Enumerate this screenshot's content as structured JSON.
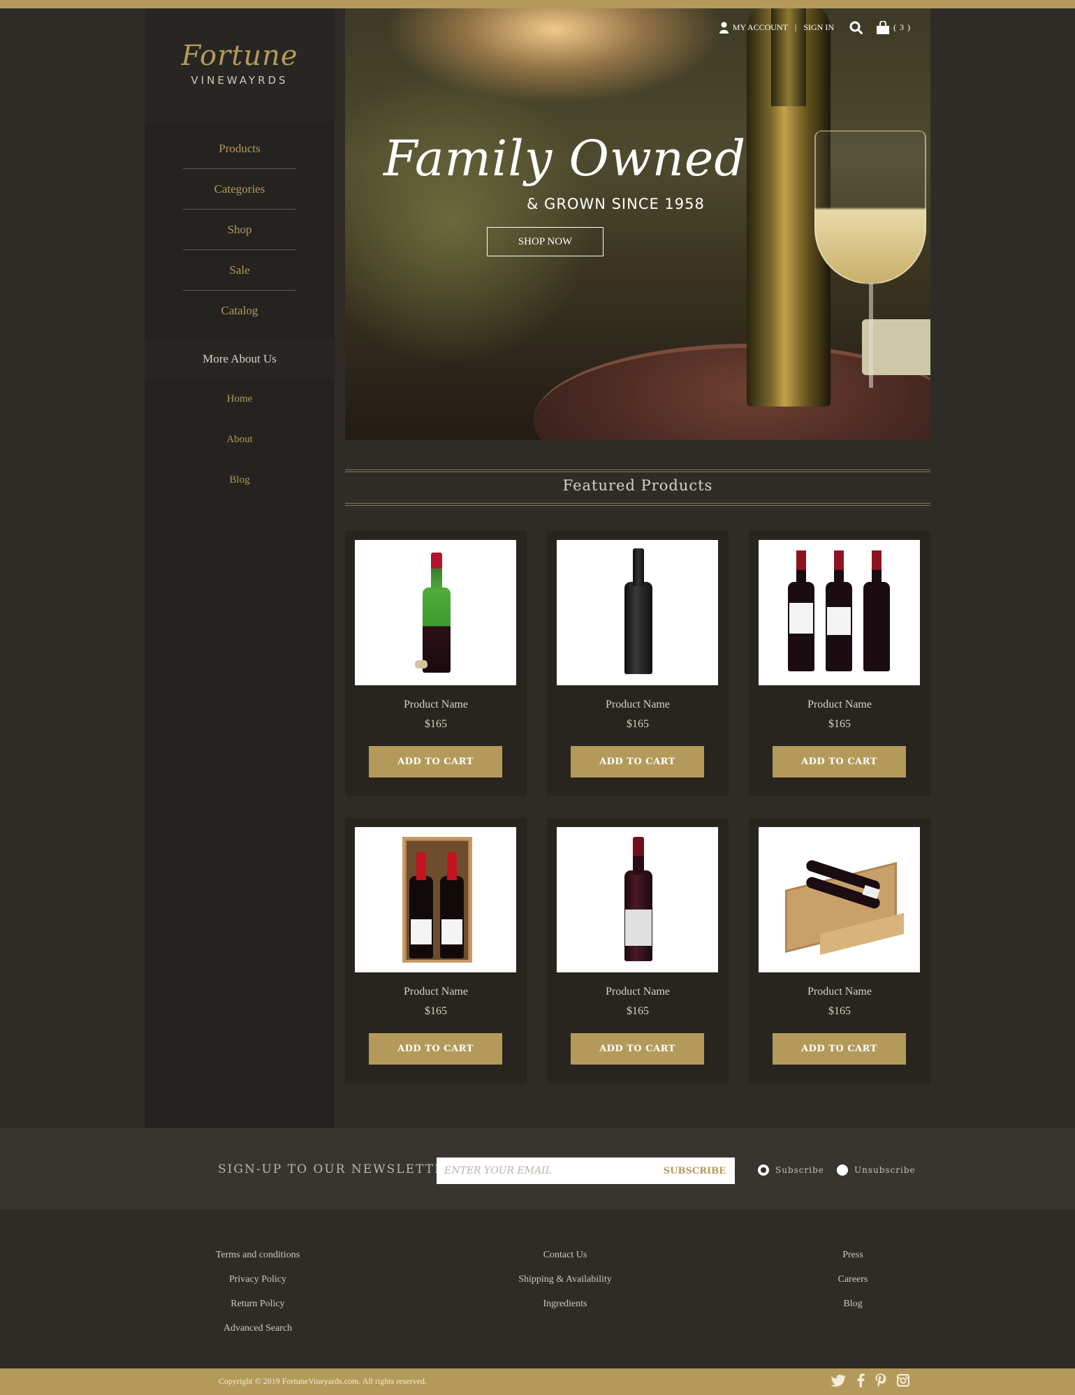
{
  "brand": {
    "logo_script": "Fortune",
    "logo_sub": "VINEWAYRDS"
  },
  "sidebar": {
    "items": [
      {
        "label": "Products"
      },
      {
        "label": "Categories"
      },
      {
        "label": "Shop"
      },
      {
        "label": "Sale"
      },
      {
        "label": "Catalog"
      }
    ],
    "more_heading": "More About Us",
    "more_items": [
      {
        "label": "Home"
      },
      {
        "label": "About"
      },
      {
        "label": "Blog"
      }
    ]
  },
  "header": {
    "account_label": "MY ACCOUNT",
    "separator": "|",
    "signin_label": "SIGN IN",
    "cart_count": "( 3 )"
  },
  "hero": {
    "title": "Family Owned",
    "subtitle": "& GROWN SINCE 1958",
    "cta": "SHOP NOW"
  },
  "featured": {
    "title": "Featured  Products",
    "products": [
      {
        "name": "Product Name",
        "price": "$165",
        "button": "ADD TO CART",
        "image": "green-wine-bottle-with-cork"
      },
      {
        "name": "Product Name",
        "price": "$165",
        "button": "ADD TO CART",
        "image": "black-wine-bottle"
      },
      {
        "name": "Product Name",
        "price": "$165",
        "button": "ADD TO CART",
        "image": "three-red-wine-bottles"
      },
      {
        "name": "Product Name",
        "price": "$165",
        "button": "ADD TO CART",
        "image": "two-bottles-in-gift-box"
      },
      {
        "name": "Product Name",
        "price": "$165",
        "button": "ADD TO CART",
        "image": "red-wine-bottle-white-label"
      },
      {
        "name": "Product Name",
        "price": "$165",
        "button": "ADD TO CART",
        "image": "wooden-crate-with-bottles"
      }
    ]
  },
  "newsletter": {
    "label": "SIGN-UP TO OUR NEWSLETTER",
    "placeholder": "ENTER YOUR EMAIL",
    "submit": "SUBSCRIBE",
    "options": [
      {
        "label": "Subscribe",
        "selected": true
      },
      {
        "label": "Unsubscribe",
        "selected": false
      }
    ]
  },
  "footer": {
    "col1": [
      "Terms and conditions",
      "Privacy Policy",
      "Return Policy",
      "Advanced Search"
    ],
    "col2": [
      "Contact Us",
      "Shipping & Availability",
      "Ingredients"
    ],
    "col3": [
      "Press",
      "Careers",
      "Blog"
    ],
    "copyright": "Copyright © 2019 FortuneVineyards.com.  All rights reserved.",
    "social_icons": [
      "twitter-icon",
      "facebook-icon",
      "pinterest-icon",
      "instagram-icon"
    ]
  },
  "colors": {
    "accent": "#b49a5a",
    "background": "#2f2c28",
    "sidebar": "#252320",
    "card": "#28251f"
  }
}
